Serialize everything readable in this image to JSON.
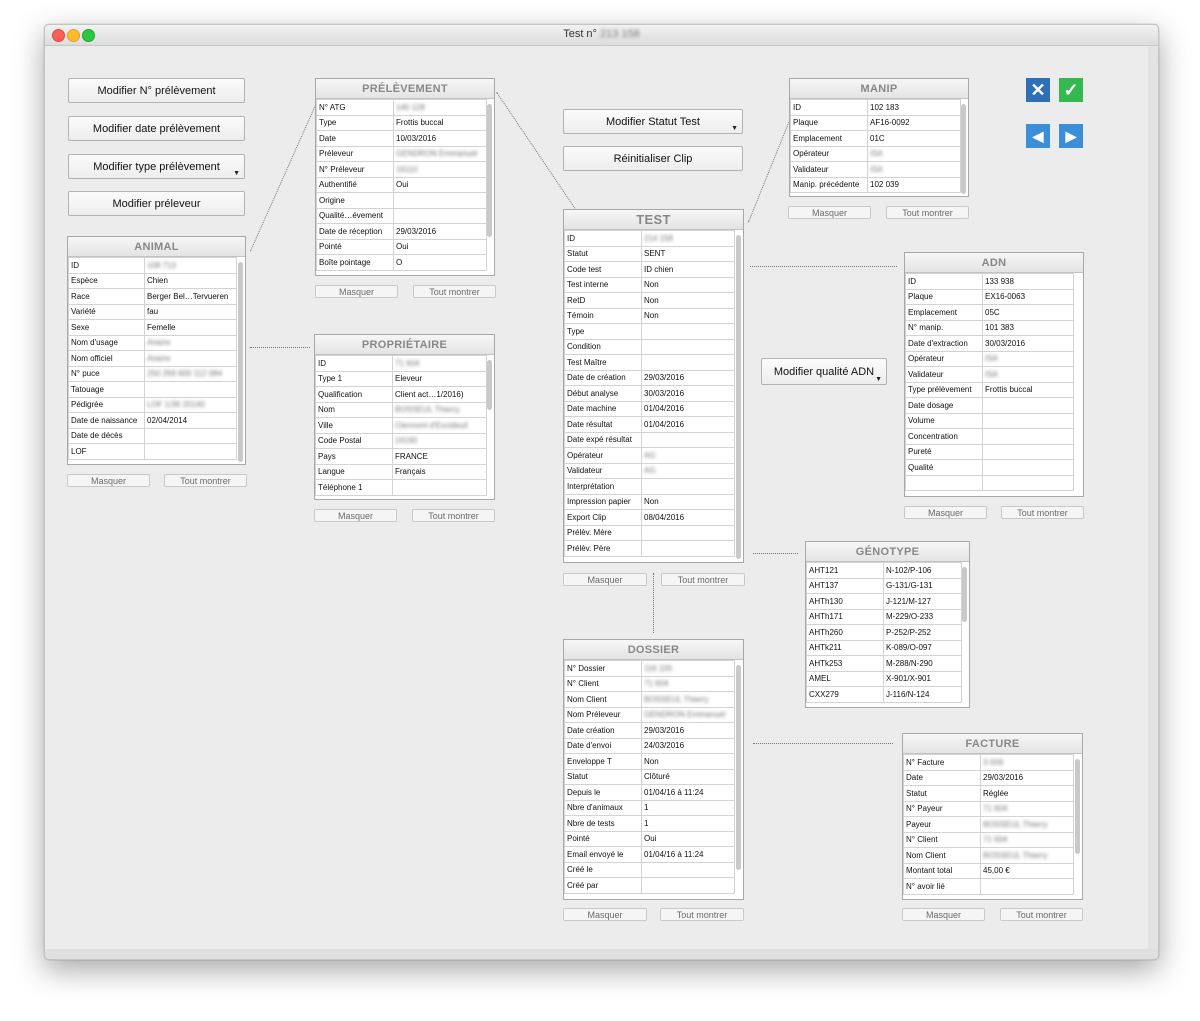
{
  "window": {
    "title": "Test n°",
    "title_blur": "213 158"
  },
  "buttons": {
    "mod_num": "Modifier N° prélèvement",
    "mod_date": "Modifier date prélèvement",
    "mod_type": "Modifier type prélèvement",
    "mod_prel": "Modifier préleveur",
    "mod_statut": "Modifier Statut Test",
    "reinit_clip": "Réinitialiser Clip",
    "mod_qualite": "Modifier qualité ADN"
  },
  "common": {
    "masquer": "Masquer",
    "tout_montrer": "Tout montrer"
  },
  "colors": {
    "accent_blue": "#3a8fd8",
    "ok_green": "#35b84f",
    "cancel_blue": "#2f6fb5"
  },
  "panels": {
    "animal": {
      "title": "ANIMAL",
      "rows": [
        [
          "ID",
          "108 713"
        ],
        [
          "Espèce",
          "Chien"
        ],
        [
          "Race",
          "Berger Bel…Tervueren"
        ],
        [
          "Variété",
          "fau"
        ],
        [
          "Sexe",
          "Femelle"
        ],
        [
          "Nom d'usage",
          "Anaïre"
        ],
        [
          "Nom officiel",
          "Anaïre"
        ],
        [
          "N° puce",
          "250 269 600 112 084"
        ],
        [
          "Tatouage",
          ""
        ],
        [
          "Pédigrée",
          "LOF 1/36 20140"
        ],
        [
          "Date de naissance",
          "02/04/2014"
        ],
        [
          "Date de décès",
          ""
        ],
        [
          "LOF",
          ""
        ]
      ]
    },
    "prelevement": {
      "title": "PRÉLÈVEMENT",
      "rows": [
        [
          "N° ATG",
          "140 128"
        ],
        [
          "Type",
          "Frottis buccal"
        ],
        [
          "Date",
          "10/03/2016"
        ],
        [
          "Préleveur",
          "GENDRON Emmanuel"
        ],
        [
          "N° Préleveur",
          "16110"
        ],
        [
          "Authentifié",
          "Oui"
        ],
        [
          "Origine",
          ""
        ],
        [
          "Qualité…évement",
          ""
        ],
        [
          "Date de réception",
          "29/03/2016"
        ],
        [
          "Pointé",
          "Oui"
        ],
        [
          "Boîte pointage",
          "O"
        ]
      ]
    },
    "proprietaire": {
      "title": "PROPRIÉTAIRE",
      "rows": [
        [
          "ID",
          "71 604"
        ],
        [
          "Type 1",
          "Eleveur"
        ],
        [
          "Qualification",
          "Client act…1/2016)"
        ],
        [
          "Nom",
          "BOSSEUL Thierry"
        ],
        [
          "Ville",
          "Clermont d'Excideuil"
        ],
        [
          "Code Postal",
          "24160"
        ],
        [
          "Pays",
          "FRANCE"
        ],
        [
          "Langue",
          "Français"
        ],
        [
          "Téléphone 1",
          ""
        ]
      ]
    },
    "test": {
      "title": "TEST",
      "rows": [
        [
          "ID",
          "214 158"
        ],
        [
          "Statut",
          "SENT"
        ],
        [
          "Code test",
          "ID chien"
        ],
        [
          "Test interne",
          "Non"
        ],
        [
          "RetD",
          "Non"
        ],
        [
          "Témoin",
          "Non"
        ],
        [
          "Type",
          ""
        ],
        [
          "Condition",
          ""
        ],
        [
          "Test Maître",
          ""
        ],
        [
          "Date de création",
          "29/03/2016"
        ],
        [
          "Début analyse",
          "30/03/2016"
        ],
        [
          "Date machine",
          "01/04/2016"
        ],
        [
          "Date résultat",
          "01/04/2016"
        ],
        [
          "Date expé résultat",
          ""
        ],
        [
          "Opérateur",
          "AG"
        ],
        [
          "Validateur",
          "AG"
        ],
        [
          "Interprétation",
          ""
        ],
        [
          "Impression papier",
          "Non"
        ],
        [
          "Export Clip",
          "08/04/2016"
        ],
        [
          "Prélèv. Mère",
          ""
        ],
        [
          "Prélèv. Père",
          ""
        ]
      ]
    },
    "manip": {
      "title": "MANIP",
      "rows": [
        [
          "ID",
          "102 183"
        ],
        [
          "Plaque",
          "AF16-0092"
        ],
        [
          "Emplacement",
          "01C"
        ],
        [
          "Opérateur",
          "ISA"
        ],
        [
          "Validateur",
          "ISA"
        ],
        [
          "Manip. précédente",
          "102 039"
        ]
      ]
    },
    "adn": {
      "title": "ADN",
      "rows": [
        [
          "ID",
          "133 938"
        ],
        [
          "Plaque",
          "EX16-0063"
        ],
        [
          "Emplacement",
          "05C"
        ],
        [
          "N° manip.",
          "101 383"
        ],
        [
          "Date d'extraction",
          "30/03/2016"
        ],
        [
          "Opérateur",
          "ISA"
        ],
        [
          "Validateur",
          "ISA"
        ],
        [
          "Type prélèvement",
          "Frottis buccal"
        ],
        [
          "Date dosage",
          ""
        ],
        [
          "Volume",
          ""
        ],
        [
          "Concentration",
          ""
        ],
        [
          "Pureté",
          ""
        ],
        [
          "Qualité",
          ""
        ],
        [
          "",
          ""
        ]
      ]
    },
    "genotype": {
      "title": "GÉNOTYPE",
      "rows": [
        [
          "AHT121",
          "N-102/P-106"
        ],
        [
          "AHT137",
          "G-131/G-131"
        ],
        [
          "AHTh130",
          "J-121/M-127"
        ],
        [
          "AHTh171",
          "M-229/O-233"
        ],
        [
          "AHTh260",
          "P-252/P-252"
        ],
        [
          "AHTk211",
          "K-089/O-097"
        ],
        [
          "AHTk253",
          "M-288/N-290"
        ],
        [
          "AMEL",
          "X-901/X-901"
        ],
        [
          "CXX279",
          "J-116/N-124"
        ]
      ]
    },
    "dossier": {
      "title": "DOSSIER",
      "rows": [
        [
          "N° Dossier",
          "116 105"
        ],
        [
          "N° Client",
          "71 604"
        ],
        [
          "Nom Client",
          "BOSSEUL Thierry"
        ],
        [
          "Nom Préleveur",
          "GENDRON Emmanuel"
        ],
        [
          "Date création",
          "29/03/2016"
        ],
        [
          "Date d'envoi",
          "24/03/2016"
        ],
        [
          "Enveloppe T",
          "Non"
        ],
        [
          "Statut",
          "Clôturé"
        ],
        [
          "Depuis le",
          "01/04/16 à 11:24"
        ],
        [
          "Nbre d'animaux",
          "1"
        ],
        [
          "Nbre de tests",
          "1"
        ],
        [
          "Pointé",
          "Oui"
        ],
        [
          "Email envoyé le",
          "01/04/16 à 11:24"
        ],
        [
          "Créé le",
          ""
        ],
        [
          "Créé par",
          ""
        ]
      ]
    },
    "facture": {
      "title": "FACTURE",
      "rows": [
        [
          "N° Facture",
          "3 009"
        ],
        [
          "Date",
          "29/03/2016"
        ],
        [
          "Statut",
          "Réglée"
        ],
        [
          "N° Payeur",
          "71 604"
        ],
        [
          "Payeur",
          "BOSSEUL Thierry"
        ],
        [
          "N° Client",
          "71 604"
        ],
        [
          "Nom Client",
          "BOSSEUL Thierry"
        ],
        [
          "Montant total",
          "45,00 €"
        ],
        [
          "N° avoir lié",
          ""
        ]
      ]
    }
  }
}
